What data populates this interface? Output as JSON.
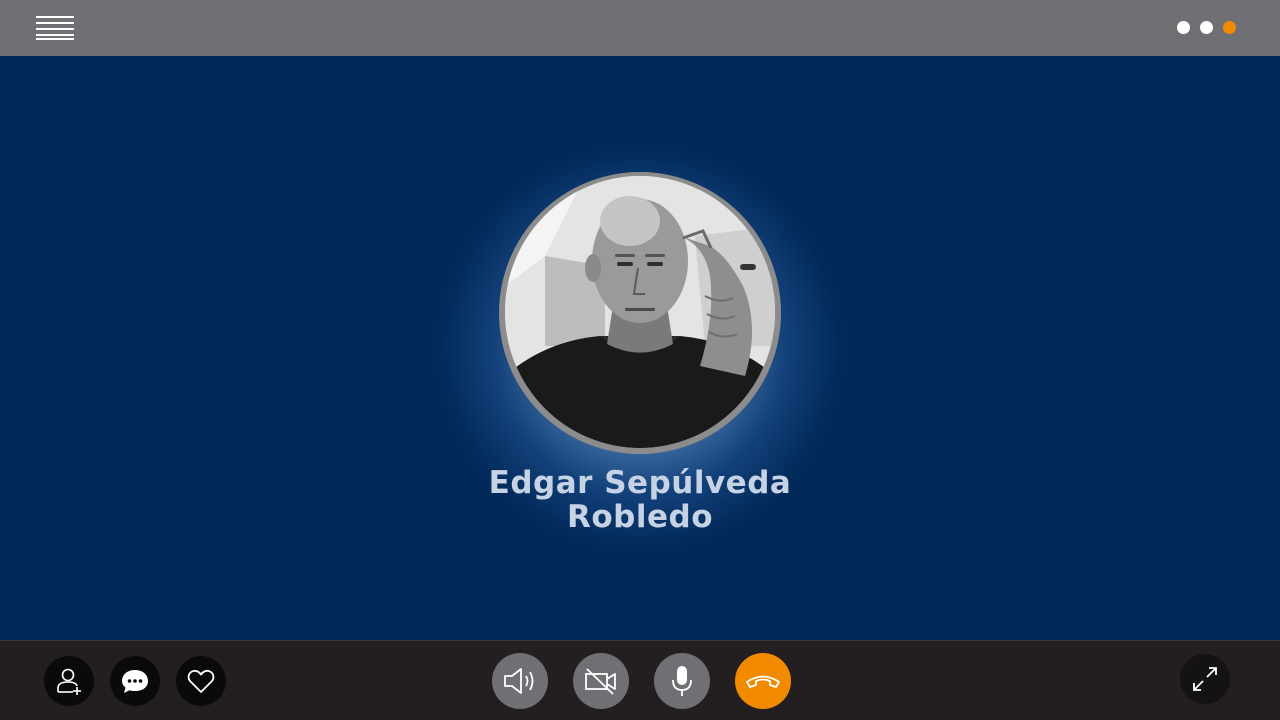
{
  "topbar": {
    "menu_icon": "hamburger-menu-icon",
    "page_dots": [
      {
        "state": "inactive",
        "color": "#ffffff"
      },
      {
        "state": "inactive",
        "color": "#ffffff"
      },
      {
        "state": "active",
        "color": "#f28a00"
      }
    ]
  },
  "call": {
    "caller_name": "Edgar Sepúlveda\nRobledo",
    "avatar_icon": "caller-avatar-photo"
  },
  "controls": {
    "left": [
      {
        "name": "add-contact",
        "icon": "add-user-icon"
      },
      {
        "name": "chat",
        "icon": "chat-bubble-icon"
      },
      {
        "name": "favorite",
        "icon": "heart-icon"
      }
    ],
    "center": [
      {
        "name": "speaker",
        "icon": "speaker-icon"
      },
      {
        "name": "video-off",
        "icon": "video-off-icon"
      },
      {
        "name": "microphone",
        "icon": "microphone-icon"
      },
      {
        "name": "hang-up",
        "icon": "hang-up-phone-icon"
      }
    ],
    "right": [
      {
        "name": "fullscreen",
        "icon": "expand-icon"
      }
    ]
  },
  "colors": {
    "accent": "#f28a00",
    "background": "#002755",
    "topbar": "#707074",
    "bottombar": "#231f20",
    "name_text": "#c6d3e4"
  }
}
